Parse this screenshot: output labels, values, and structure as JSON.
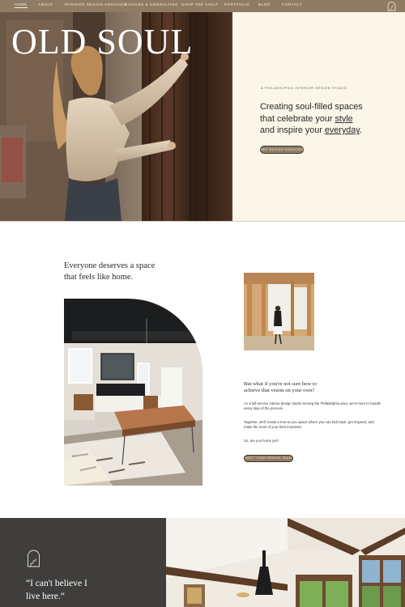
{
  "nav": {
    "items": [
      {
        "label": "HOME",
        "active": true
      },
      {
        "label": "ABOUT",
        "active": false
      },
      {
        "label": "INTERIOR DESIGN SERVICES",
        "active": false
      },
      {
        "label": "STAGING & CONSULTING",
        "active": false
      },
      {
        "label": "SHOP THE VAULT",
        "active": false
      },
      {
        "label": "PORTFOLIO",
        "active": false
      },
      {
        "label": "BLOG",
        "active": false
      },
      {
        "label": "CONTACT",
        "active": false
      }
    ],
    "logo_icon": "arch-monogram-icon",
    "bg_color": "#8f7c62"
  },
  "hero": {
    "brand": "OLD SOUL",
    "eyebrow": "A PHILADELPHIA INTERIOR DESIGN STUDIO",
    "heading_line1": "Creating soul-filled spaces",
    "heading_line2_pre": "that celebrate your ",
    "heading_line2_link": "style",
    "heading_line3_pre": "and inspire your ",
    "heading_line3_link": "everyday",
    "heading_line3_post": ".",
    "button_label": "SEE DESIGN SERVICES",
    "panel_color": "#fbf6e8"
  },
  "intro": {
    "heading_line1": "Everyone deserves a space",
    "heading_line2": "that feels like home.",
    "question_line1": "But what if you're not sure how to",
    "question_line2": "achieve that vision on your own?",
    "paragraphs": [
      "As a full-service interior design studio serving the Philadelphia area, we're here to handle every step of the process.",
      "Together, we'll create a true-to-you space where you can kick back, get inspired, and make the most of your best moments.",
      "So, are you home yet?"
    ],
    "button_label": "MEET YOUR DESIGN TEAM"
  },
  "testimonial": {
    "quote_line1": "“I can't believe I",
    "quote_line2": "live here.”",
    "icon": "arch-doorway-icon",
    "panel_color": "#3f3e3c"
  }
}
